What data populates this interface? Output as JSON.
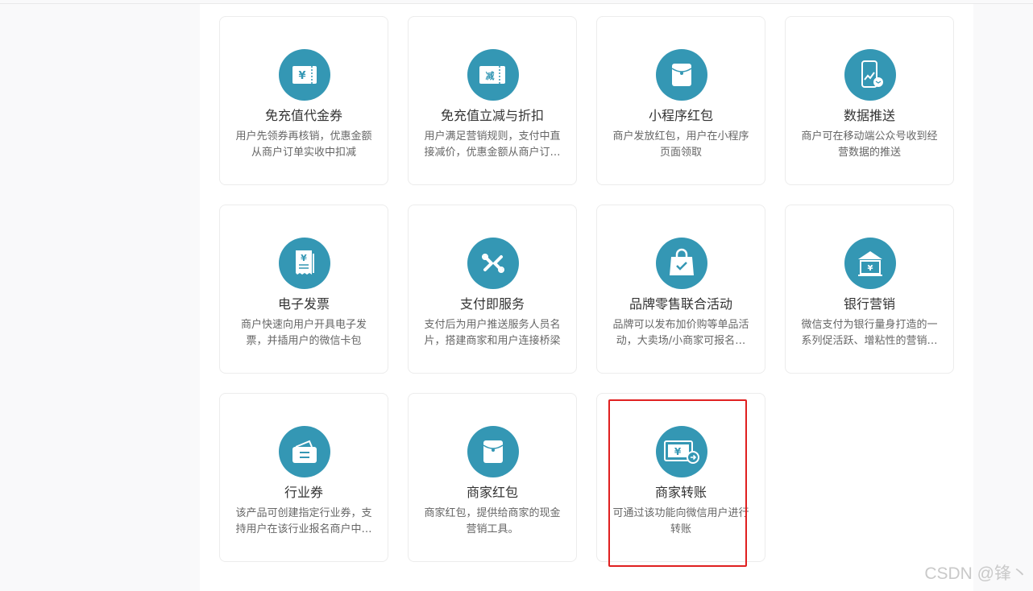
{
  "products": [
    {
      "title": "免充值代金券",
      "desc": "用户先领券再核销，优惠金额从商户订单实收中扣减",
      "icon": "voucher-icon"
    },
    {
      "title": "免充值立减与折扣",
      "desc": "用户满足营销规则，支付中直接减价，优惠金额从商户订单实收中扣减",
      "icon": "discount-icon"
    },
    {
      "title": "小程序红包",
      "desc": "商户发放红包，用户在小程序页面领取",
      "icon": "red-packet-icon"
    },
    {
      "title": "数据推送",
      "desc": "商户可在移动端公众号收到经营数据的推送",
      "icon": "data-push-icon"
    },
    {
      "title": "电子发票",
      "desc": "商户快速向用户开具电子发票，并插用户的微信卡包",
      "icon": "invoice-icon"
    },
    {
      "title": "支付即服务",
      "desc": "支付后为用户推送服务人员名片，搭建商家和用户连接桥梁",
      "icon": "service-icon"
    },
    {
      "title": "品牌零售联合活动",
      "desc": "品牌可以发布加价购等单品活动，大卖场/小商家可报名参与",
      "icon": "shopping-bag-icon"
    },
    {
      "title": "银行营销",
      "desc": "微信支付为银行量身打造的一系列促活跃、增粘性的营销工具",
      "icon": "bank-icon"
    },
    {
      "title": "行业券",
      "desc": "该产品可创建指定行业券，支持用户在该行业报名商户中使用",
      "icon": "wallet-icon"
    },
    {
      "title": "商家红包",
      "desc": "商家红包，提供给商家的现金营销工具。",
      "icon": "red-packet-icon"
    },
    {
      "title": "商家转账",
      "desc": "可通过该功能向微信用户进行转账",
      "icon": "transfer-icon"
    }
  ],
  "colors": {
    "icon_bg": "#3497b4",
    "highlight": "#e02020"
  },
  "watermark": "CSDN @锋丶"
}
